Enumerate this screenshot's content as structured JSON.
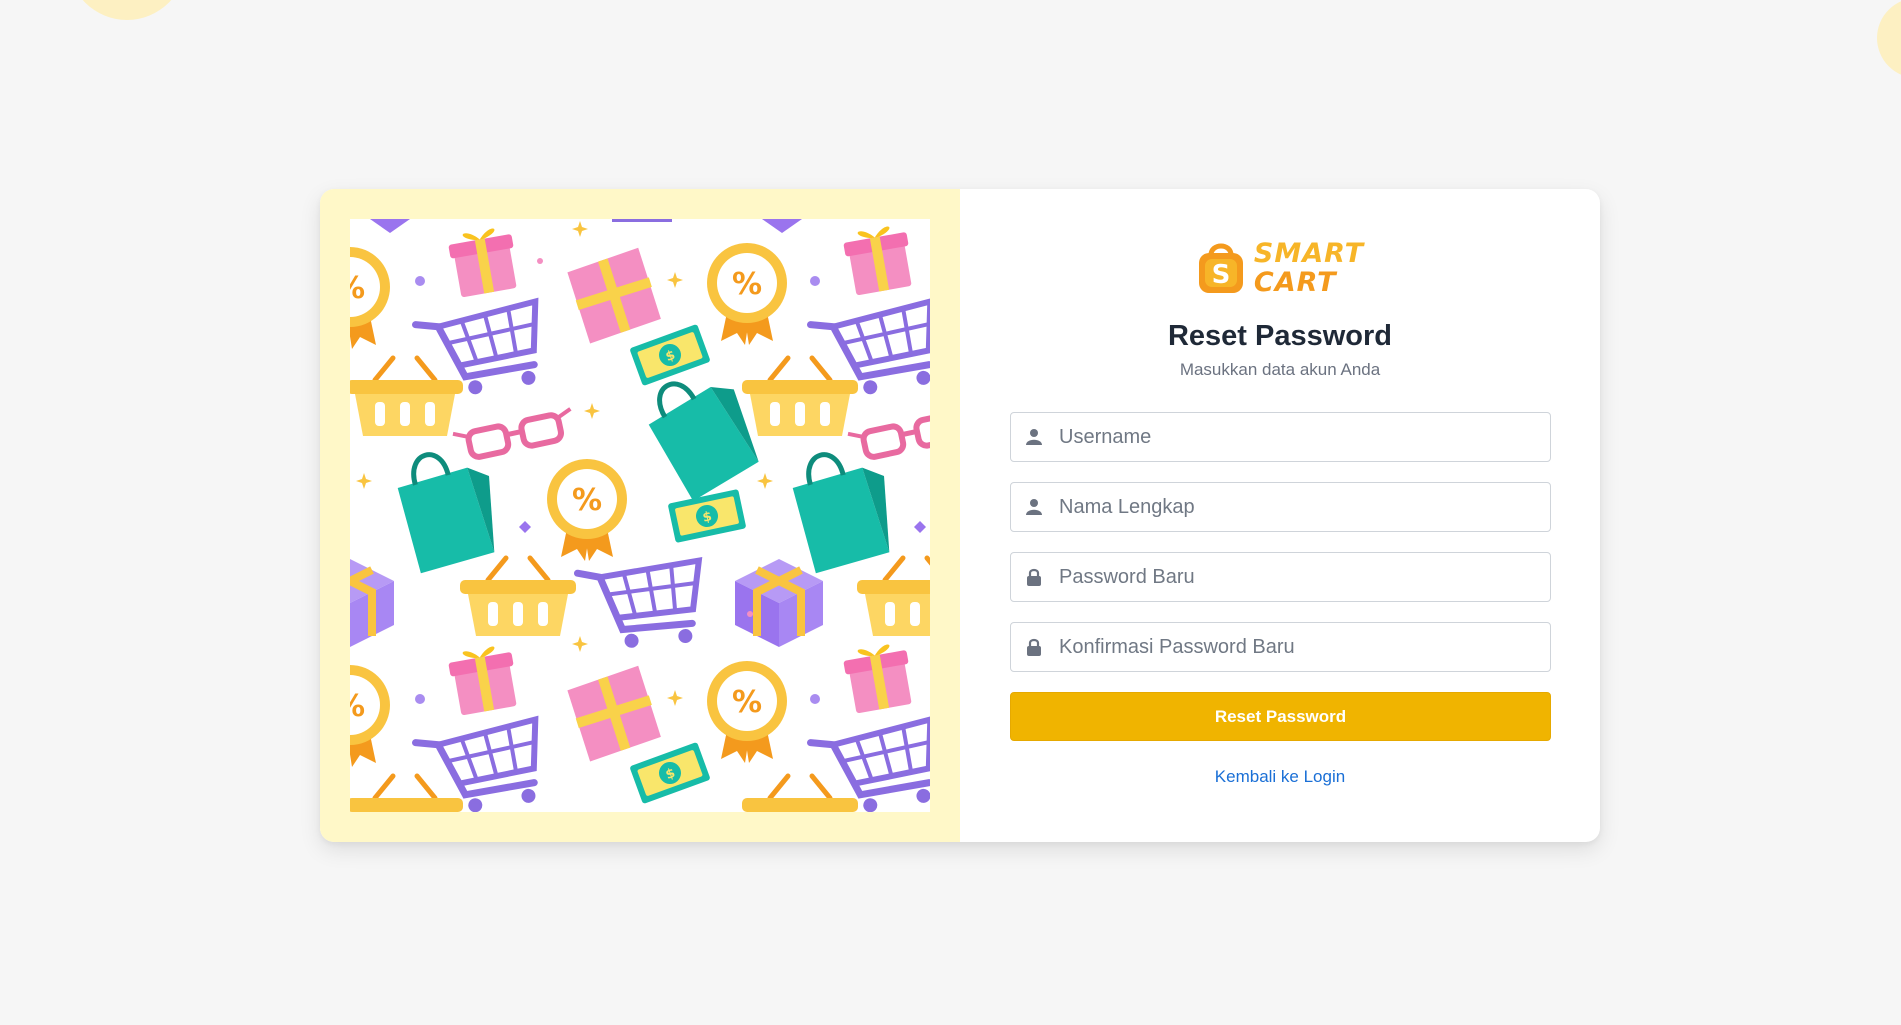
{
  "brand": {
    "line1": "SMART",
    "line2": "CART",
    "logo_icon": "shopping-bag-s-icon"
  },
  "page": {
    "title": "Reset Password",
    "subtitle": "Masukkan data akun Anda"
  },
  "form": {
    "username_placeholder": "Username",
    "fullname_placeholder": "Nama Lengkap",
    "new_password_placeholder": "Password Baru",
    "confirm_password_placeholder": "Konfirmasi Password Baru",
    "submit_label": "Reset Password"
  },
  "links": {
    "back_to_login": "Kembali ke Login"
  },
  "colors": {
    "accent": "#f0b400",
    "panel_bg": "#fff8c8",
    "link": "#1a6fd6",
    "title": "#1f2937"
  },
  "illustration": {
    "icons": [
      "gift-icon",
      "shopping-cart-icon",
      "basket-icon",
      "shopping-bag-icon",
      "discount-badge-icon",
      "glasses-icon",
      "money-icon",
      "sparkle-icon"
    ]
  }
}
